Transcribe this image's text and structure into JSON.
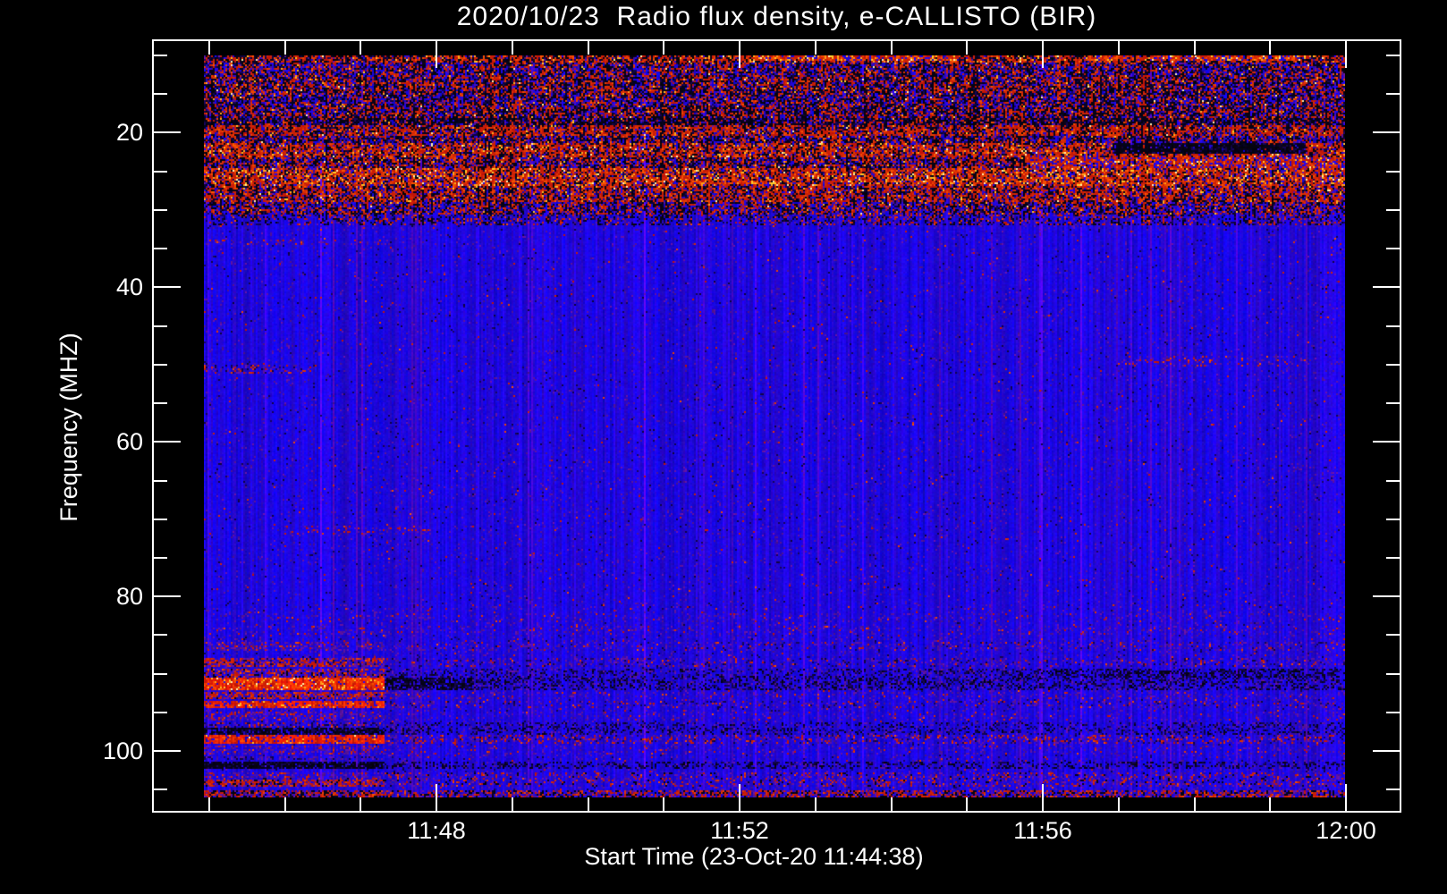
{
  "window": {
    "bg": "#000000",
    "fg": "#ffffff"
  },
  "chart_data": {
    "type": "heatmap",
    "title": "2020/10/23  Radio flux density, e-CALLISTO (BIR)",
    "xlabel": "Start Time (23-Oct-20 11:44:38)",
    "ylabel": "Frequency (MHZ)",
    "legend": "none",
    "grid": false,
    "y_axis": {
      "ticks": [
        20,
        40,
        60,
        80,
        100
      ],
      "minor_ticks": [
        10,
        15,
        25,
        30,
        35,
        45,
        50,
        55,
        65,
        70,
        75,
        85,
        90,
        95,
        105
      ],
      "unit": "MHz",
      "range_top_mhz": 10.0,
      "range_bottom_mhz": 106.0,
      "direction": "increasing-downward"
    },
    "x_axis": {
      "major_ticks": [
        "11:48",
        "11:52",
        "11:56",
        "12:00"
      ],
      "minor_interval": "1 min",
      "start_time": "11:44:38",
      "date": "23-Oct-20"
    },
    "palette": {
      "background": "#000000",
      "axis": "#ffffff",
      "text": "#ffffff",
      "base_blue": "#1c0ae6",
      "red": "#c01208",
      "orange": "#ff5a00",
      "yellow": "#ffd22a",
      "hot_white": "#fff1b0",
      "purple": "#5a129b",
      "dark_navy": "#1a0566",
      "black": "#000008"
    },
    "regions": {
      "top_noise_base": {
        "max_f": 32.0,
        "p": 0.02,
        "d": 0.012,
        "r": 0.004
      },
      "mid_base": {
        "p": 0.035,
        "d": 0.012,
        "r": 0.004
      },
      "bottom_base": {
        "min_f": 81.0,
        "p": 0.06,
        "d": 0.02,
        "r": 0.01
      }
    },
    "rfi_bands": [
      {
        "f0": 10.0,
        "f1": 10.9,
        "h": 0.1,
        "r": 0.36,
        "k": 0.26,
        "d": 0.14
      },
      {
        "f0": 10.9,
        "f1": 12.7,
        "h": 0.03,
        "r": 0.22,
        "k": 0.24,
        "d": 0.12
      },
      {
        "f0": 12.7,
        "f1": 15.0,
        "h": 0.04,
        "r": 0.26,
        "k": 0.28,
        "d": 0.12
      },
      {
        "f0": 15.0,
        "f1": 16.7,
        "h": 0.03,
        "r": 0.2,
        "k": 0.24,
        "d": 0.12
      },
      {
        "f0": 16.7,
        "f1": 18.2,
        "h": 0.02,
        "r": 0.24,
        "k": 0.3,
        "d": 0.12
      },
      {
        "f0": 18.2,
        "f1": 19.0,
        "h": 0.01,
        "r": 0.14,
        "k": 0.46,
        "d": 0.16
      },
      {
        "f0": 19.0,
        "f1": 20.3,
        "h": 0.05,
        "r": 0.46,
        "k": 0.2,
        "d": 0.1
      },
      {
        "f0": 20.3,
        "f1": 21.3,
        "h": 0.03,
        "r": 0.2,
        "k": 0.26,
        "d": 0.12
      },
      {
        "f0": 21.3,
        "f1": 23.1,
        "h": 0.12,
        "r": 0.44,
        "k": 0.16,
        "d": 0.08
      },
      {
        "f0": 23.1,
        "f1": 24.5,
        "h": 0.04,
        "r": 0.28,
        "k": 0.26,
        "d": 0.1
      },
      {
        "f0": 24.5,
        "f1": 26.8,
        "h": 0.2,
        "r": 0.42,
        "k": 0.12,
        "d": 0.08
      },
      {
        "f0": 26.8,
        "f1": 28.9,
        "h": 0.06,
        "r": 0.4,
        "k": 0.18,
        "d": 0.1
      },
      {
        "f0": 28.9,
        "f1": 30.5,
        "h": 0.02,
        "r": 0.22,
        "k": 0.2,
        "d": 0.1
      },
      {
        "f0": 30.5,
        "f1": 32.0,
        "h": 0.0,
        "r": 0.1,
        "k": 0.1,
        "d": 0.08
      }
    ],
    "bottom_rows": [
      {
        "f0": 82.0,
        "f1": 83.3,
        "p": 0.1,
        "r": 0.02
      },
      {
        "f0": 83.8,
        "f1": 85.0,
        "p": 0.12,
        "r": 0.03
      },
      {
        "f0": 85.8,
        "f1": 87.0,
        "p": 0.14,
        "r": 0.04,
        "d": 0.04
      },
      {
        "f0": 88.0,
        "f1": 89.2,
        "p": 0.16,
        "r": 0.05,
        "d": 0.06
      },
      {
        "f0": 89.4,
        "f1": 90.4,
        "d": 0.18,
        "k": 0.08,
        "p": 0.1
      },
      {
        "f0": 90.6,
        "f1": 92.1,
        "d": 0.22,
        "k": 0.14,
        "p": 0.08
      },
      {
        "f0": 92.3,
        "f1": 93.3,
        "p": 0.14,
        "r": 0.04
      },
      {
        "f0": 93.5,
        "f1": 94.5,
        "p": 0.12,
        "r": 0.05,
        "d": 0.06
      },
      {
        "f0": 94.8,
        "f1": 96.0,
        "p": 0.1,
        "r": 0.03
      },
      {
        "f0": 96.2,
        "f1": 97.9,
        "d": 0.16,
        "k": 0.08,
        "p": 0.08
      },
      {
        "f0": 98.0,
        "f1": 99.0,
        "r": 0.14,
        "p": 0.14,
        "d": 0.06
      },
      {
        "f0": 99.3,
        "f1": 100.5,
        "p": 0.1,
        "r": 0.03
      },
      {
        "f0": 101.3,
        "f1": 102.4,
        "k": 0.14,
        "d": 0.16,
        "p": 0.06
      },
      {
        "f0": 102.7,
        "f1": 104.7,
        "r": 0.12,
        "p": 0.14,
        "k": 0.05
      },
      {
        "f0": 105.0,
        "f1": 106.0,
        "r": 0.3,
        "k": 0.2,
        "p": 0.15
      }
    ],
    "left_block": {
      "x_end_frac": 0.157,
      "stripes": [
        {
          "f0": 85.8,
          "f1": 87.0,
          "p": 0.3,
          "r": 0.12
        },
        {
          "f0": 88.0,
          "f1": 89.2,
          "r": 0.4,
          "p": 0.25,
          "d": 0.1
        },
        {
          "f0": 89.4,
          "f1": 90.4,
          "r": 0.3,
          "p": 0.25,
          "k": 0.1
        },
        {
          "f0": 90.6,
          "f1": 92.1,
          "h": 0.22,
          "r": 0.72,
          "bright": 1
        },
        {
          "f0": 92.3,
          "f1": 93.3,
          "r": 0.45,
          "p": 0.2,
          "k": 0.08
        },
        {
          "f0": 93.5,
          "f1": 94.5,
          "r": 0.78,
          "h": 0.06,
          "bright": 1
        },
        {
          "f0": 94.8,
          "f1": 96.0,
          "p": 0.3,
          "r": 0.12
        },
        {
          "f0": 96.2,
          "f1": 96.9,
          "p": 0.2,
          "r": 0.1,
          "d": 0.15
        },
        {
          "f0": 97.0,
          "f1": 97.9,
          "k": 0.5,
          "d": 0.3
        },
        {
          "f0": 98.0,
          "f1": 99.0,
          "r": 0.8,
          "h": 0.07,
          "bright": 1
        },
        {
          "f0": 99.3,
          "f1": 100.5,
          "p": 0.28,
          "r": 0.1
        },
        {
          "f0": 100.7,
          "f1": 101.2,
          "p": 0.2,
          "d": 0.15
        },
        {
          "f0": 101.3,
          "f1": 102.4,
          "k": 0.65,
          "d": 0.22
        },
        {
          "f0": 102.7,
          "f1": 103.4,
          "p": 0.3,
          "r": 0.15
        },
        {
          "f0": 103.6,
          "f1": 104.7,
          "r": 0.45,
          "k": 0.15,
          "p": 0.2
        },
        {
          "f0": 105.0,
          "f1": 106.0,
          "r": 0.4,
          "k": 0.25,
          "p": 0.2
        }
      ]
    },
    "accents": [
      {
        "x0": 0.48,
        "x1": 0.66,
        "f0": 10.0,
        "f1": 10.8,
        "h": 0.3,
        "r": 0.45
      },
      {
        "x0": 0.77,
        "x1": 0.96,
        "f0": 10.0,
        "f1": 10.8,
        "h": 0.26,
        "r": 0.5
      },
      {
        "x0": 0.795,
        "x1": 0.965,
        "f0": 21.3,
        "f1": 22.8,
        "k": 0.7,
        "d": 0.2
      },
      {
        "x0": 0.72,
        "x1": 0.995,
        "f0": 23.3,
        "f1": 24.5,
        "r": 0.5,
        "h": 0.13
      },
      {
        "x0": 0.157,
        "x1": 0.235,
        "f0": 90.6,
        "f1": 92.1,
        "k": 0.45,
        "d": 0.3
      },
      {
        "x0": 0.74,
        "x1": 1.0,
        "f0": 89.4,
        "f1": 90.4,
        "k": 0.25,
        "d": 0.25
      },
      {
        "x0": 0.0,
        "x1": 0.1,
        "f0": 50.0,
        "f1": 51.1,
        "r": 0.1,
        "p": 0.16,
        "d": 0.08
      },
      {
        "x0": 0.07,
        "x1": 0.2,
        "f0": 70.8,
        "f1": 72.0,
        "r": 0.07,
        "p": 0.12
      },
      {
        "x0": 0.0,
        "x1": 0.16,
        "f0": 33.8,
        "f1": 34.6,
        "r": 0.08,
        "p": 0.12
      },
      {
        "x0": 0.8,
        "x1": 0.97,
        "f0": 48.9,
        "f1": 50.3,
        "r": 0.07,
        "p": 0.11
      }
    ]
  }
}
